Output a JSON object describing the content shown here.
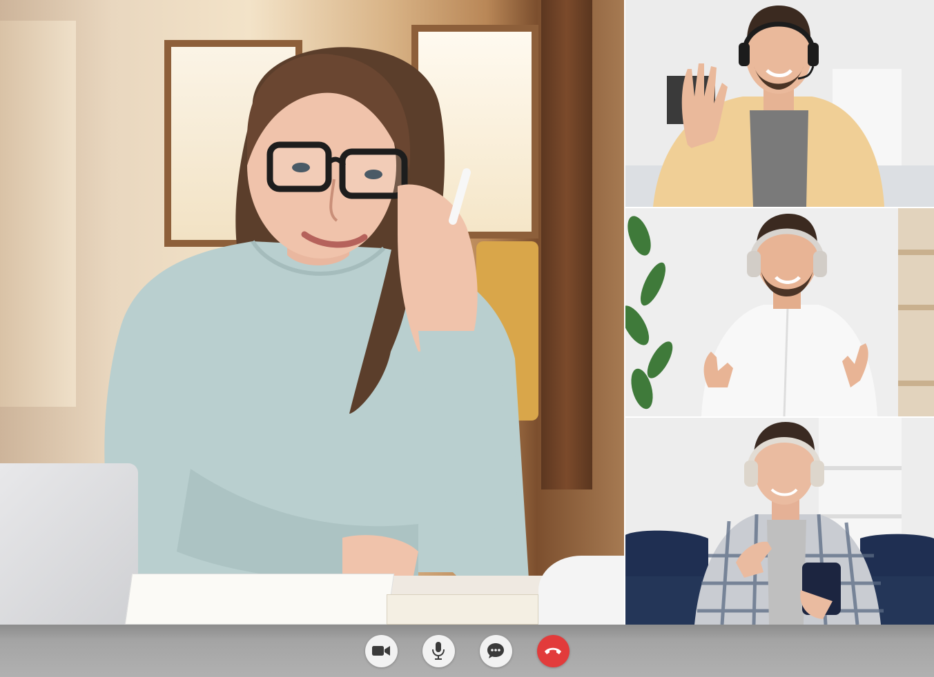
{
  "app": {
    "type": "video-call"
  },
  "participants": [
    {
      "role": "main-speaker",
      "description_icon": "avatar-woman-glasses"
    },
    {
      "role": "participant",
      "description_icon": "avatar-man-headset-waving"
    },
    {
      "role": "participant",
      "description_icon": "avatar-man-white-shirt-headphones"
    },
    {
      "role": "participant",
      "description_icon": "avatar-man-plaid-shirt-phone"
    }
  ],
  "controls": [
    {
      "id": "camera",
      "icon": "video-camera-icon"
    },
    {
      "id": "microphone",
      "icon": "microphone-icon"
    },
    {
      "id": "chat",
      "icon": "chat-bubble-icon"
    },
    {
      "id": "end-call",
      "icon": "hang-up-phone-icon",
      "color": "#e23b3b"
    }
  ],
  "colors": {
    "control_bar": "#a4a4a4",
    "button_bg": "#f2f2f2",
    "end_call": "#e23b3b",
    "icon": "#3a3a3a"
  }
}
